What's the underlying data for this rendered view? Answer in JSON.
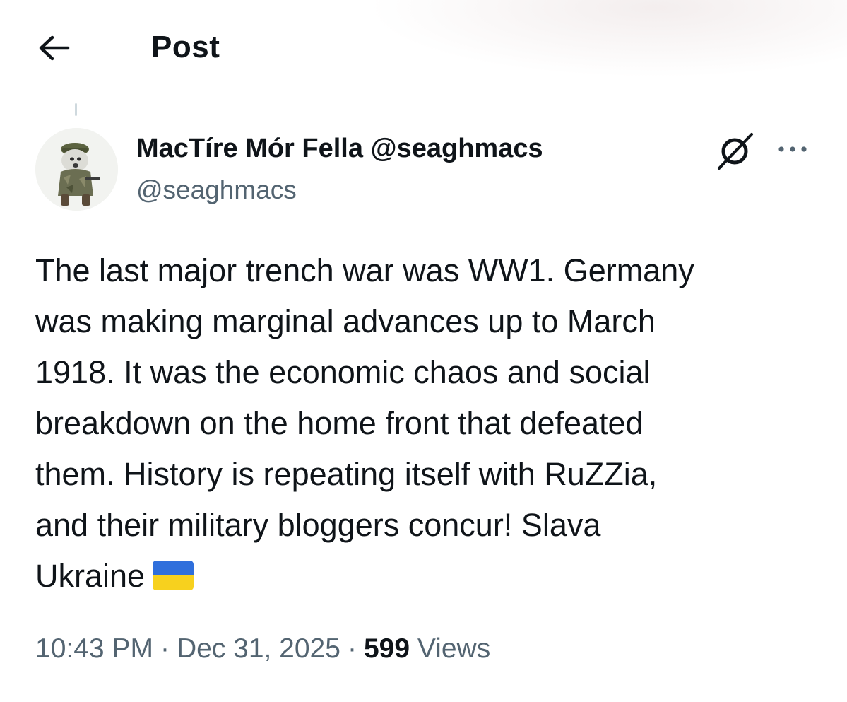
{
  "header": {
    "title": "Post",
    "back_icon": "arrow-left-icon"
  },
  "author": {
    "display_name": "MacTíre Mór Fella @seaghmacs",
    "handle": "@seaghmacs",
    "avatar": "dog-avatar"
  },
  "actions": {
    "grok_icon": "grok-icon",
    "more_icon": "more-dots-icon"
  },
  "post": {
    "lines": [
      "The last major trench war was WW1. Germany",
      "was making marginal advances up to March",
      "1918. It was the economic chaos and social",
      "breakdown on the home front that defeated",
      "them. History is repeating itself with RuZZia,",
      "and their military bloggers concur! Slava",
      "Ukraine"
    ],
    "flag_emoji": "ukraine-flag-emoji"
  },
  "meta": {
    "time": "10:43 PM",
    "date": "Dec 31, 2025",
    "separator": "·",
    "views_count": "599",
    "views_label": "Views"
  },
  "colors": {
    "text_primary": "#0f1419",
    "text_secondary": "#536471",
    "flag_blue": "#2f6fdc",
    "flag_yellow": "#f7d11e"
  }
}
